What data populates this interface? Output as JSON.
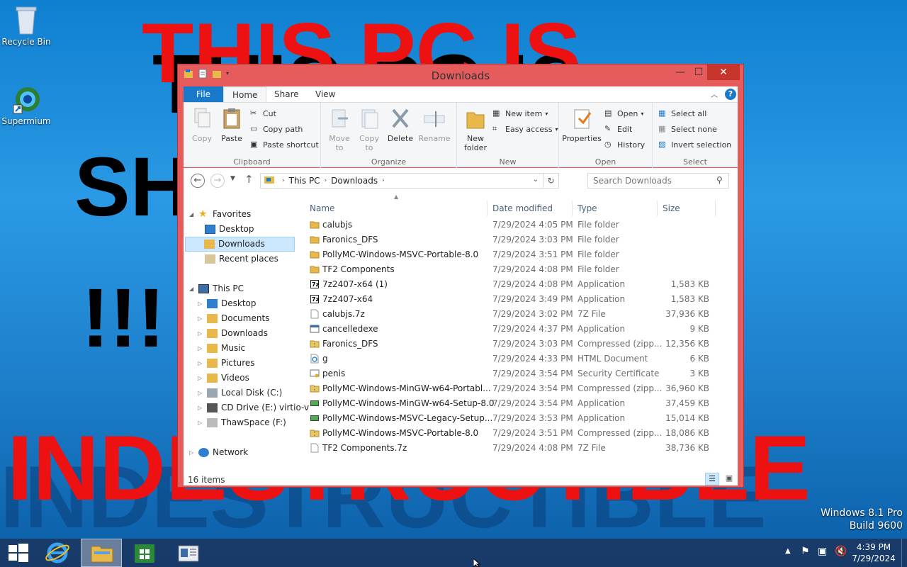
{
  "desktop": {
    "wallpaper_red_lines": [
      "THIS PC IS",
      "INDESTRUCTIBLE"
    ],
    "wallpaper_black_lines": [
      "THIS PC IS",
      "SHIELDED",
      "!!!",
      "INDESTRUCTIBLE"
    ],
    "icons": [
      {
        "label": "Recycle Bin",
        "icon": "recycle-bin-icon"
      },
      {
        "label": "Supermium",
        "icon": "supermium-icon"
      }
    ],
    "watermark": {
      "line1": "Windows 8.1 Pro",
      "line2": "Build 9600"
    }
  },
  "window": {
    "title": "Downloads",
    "controls": {
      "minimize": "—",
      "maximize": "☐",
      "close": "✕"
    },
    "tabs": [
      "File",
      "Home",
      "Share",
      "View"
    ],
    "ribbon": {
      "clipboard": {
        "label": "Clipboard",
        "copy": "Copy",
        "paste": "Paste",
        "cut": "Cut",
        "copy_path": "Copy path",
        "paste_shortcut": "Paste shortcut"
      },
      "organize": {
        "label": "Organize",
        "move_to": "Move to",
        "copy_to": "Copy to",
        "delete": "Delete",
        "rename": "Rename"
      },
      "new": {
        "label": "New",
        "new_folder": "New folder",
        "new_item": "New item",
        "easy_access": "Easy access"
      },
      "open": {
        "label": "Open",
        "properties": "Properties",
        "open": "Open",
        "edit": "Edit",
        "history": "History"
      },
      "select": {
        "label": "Select",
        "select_all": "Select all",
        "select_none": "Select none",
        "invert_selection": "Invert selection"
      }
    },
    "address": {
      "segments": [
        "This PC",
        "Downloads"
      ]
    },
    "search": {
      "placeholder": "Search Downloads"
    },
    "nav_tree": {
      "favorites": "Favorites",
      "favorites_items": [
        "Desktop",
        "Downloads",
        "Recent places"
      ],
      "this_pc": "This PC",
      "this_pc_items": [
        "Desktop",
        "Documents",
        "Downloads",
        "Music",
        "Pictures",
        "Videos",
        "Local Disk (C:)",
        "CD Drive (E:) virtio-v",
        "ThawSpace (F:)"
      ],
      "network": "Network"
    },
    "columns": {
      "name": "Name",
      "date": "Date modified",
      "type": "Type",
      "size": "Size"
    },
    "files": [
      {
        "name": "calubjs",
        "date": "7/29/2024 4:05 PM",
        "type": "File folder",
        "size": "",
        "icon": "folder-icon"
      },
      {
        "name": "Faronics_DFS",
        "date": "7/29/2024 3:03 PM",
        "type": "File folder",
        "size": "",
        "icon": "folder-icon"
      },
      {
        "name": "PollyMC-Windows-MSVC-Portable-8.0",
        "date": "7/29/2024 3:51 PM",
        "type": "File folder",
        "size": "",
        "icon": "folder-icon"
      },
      {
        "name": "TF2 Components",
        "date": "7/29/2024 4:08 PM",
        "type": "File folder",
        "size": "",
        "icon": "folder-icon"
      },
      {
        "name": "7z2407-x64 (1)",
        "date": "7/29/2024 4:08 PM",
        "type": "Application",
        "size": "1,583 KB",
        "icon": "7zip-icon"
      },
      {
        "name": "7z2407-x64",
        "date": "7/29/2024 3:49 PM",
        "type": "Application",
        "size": "1,583 KB",
        "icon": "7zip-icon"
      },
      {
        "name": "calubjs.7z",
        "date": "7/29/2024 3:02 PM",
        "type": "7Z File",
        "size": "37,936 KB",
        "icon": "file-icon"
      },
      {
        "name": "cancelledexe",
        "date": "7/29/2024 4:37 PM",
        "type": "Application",
        "size": "9 KB",
        "icon": "app-icon"
      },
      {
        "name": "Faronics_DFS",
        "date": "7/29/2024 3:03 PM",
        "type": "Compressed (zipp...",
        "size": "12,356 KB",
        "icon": "zip-folder-icon"
      },
      {
        "name": "g",
        "date": "7/29/2024 4:33 PM",
        "type": "HTML Document",
        "size": "6 KB",
        "icon": "ie-document-icon"
      },
      {
        "name": "penis",
        "date": "7/29/2024 3:54 PM",
        "type": "Security Certificate",
        "size": "3 KB",
        "icon": "certificate-icon"
      },
      {
        "name": "PollyMC-Windows-MinGW-w64-Portabl...",
        "date": "7/29/2024 3:54 PM",
        "type": "Compressed (zipp...",
        "size": "36,960 KB",
        "icon": "zip-folder-icon"
      },
      {
        "name": "PollyMC-Windows-MinGW-w64-Setup-8.0",
        "date": "7/29/2024 3:54 PM",
        "type": "Application",
        "size": "37,459 KB",
        "icon": "installer-icon"
      },
      {
        "name": "PollyMC-Windows-MSVC-Legacy-Setup...",
        "date": "7/29/2024 3:53 PM",
        "type": "Application",
        "size": "15,014 KB",
        "icon": "installer-icon"
      },
      {
        "name": "PollyMC-Windows-MSVC-Portable-8.0",
        "date": "7/29/2024 3:51 PM",
        "type": "Compressed (zipp...",
        "size": "18,086 KB",
        "icon": "zip-folder-icon"
      },
      {
        "name": "TF2 Components.7z",
        "date": "7/29/2024 4:08 PM",
        "type": "7Z File",
        "size": "38,736 KB",
        "icon": "file-icon"
      }
    ],
    "status": {
      "items_count": "16 items"
    }
  },
  "taskbar": {
    "clock_time": "4:39 PM",
    "clock_date": "7/29/2024",
    "pinned": [
      "start-button",
      "internet-explorer-icon",
      "file-explorer-icon",
      "store-icon",
      "control-panel-icon"
    ]
  },
  "colors": {
    "accent": "#1979ca",
    "window_frame": "#e65b5b",
    "close_button": "#c7342b",
    "selection": "#cce8ff",
    "folder": "#e8b84a"
  }
}
